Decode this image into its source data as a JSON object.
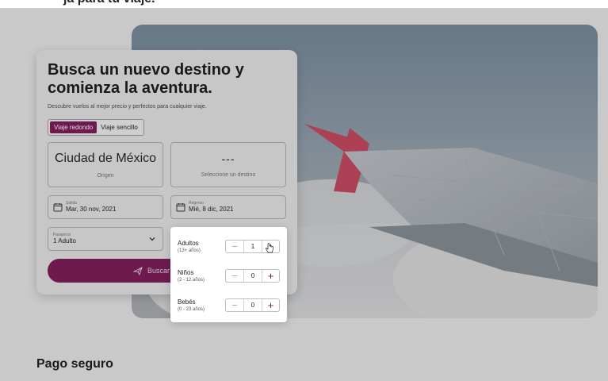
{
  "top_caption": "ja para tu viaje.",
  "hero": {
    "title": "Busca un nuevo destino y comienza la aventura.",
    "subtitle": "Descubre vuelos al mejor precio y perfectos para cualquier viaje."
  },
  "trip_type": {
    "options": [
      "Viaje redondo",
      "Viaje sencillo"
    ],
    "selected": "Viaje redondo"
  },
  "origin": {
    "value": "Ciudad de México",
    "label": "Origen"
  },
  "destination": {
    "value": "---",
    "label": "Seleccione un destino"
  },
  "departure": {
    "small_label": "Salida",
    "value": "Mar, 30 nov, 2021"
  },
  "return": {
    "small_label": "Regreso",
    "value": "Mié, 8 dic, 2021"
  },
  "passengers": {
    "small_label": "Pasajeros",
    "value": "1 Adulto"
  },
  "search_button": {
    "label": "Buscar"
  },
  "passenger_popup": {
    "rows": [
      {
        "name": "Adultos",
        "age": "(13+ años)",
        "count": "1"
      },
      {
        "name": "Niños",
        "age": "(2 - 12 años)",
        "count": "0"
      },
      {
        "name": "Bebés",
        "age": "(0 - 23 años)",
        "count": "0"
      }
    ]
  },
  "section_title": "Pago seguro",
  "colors": {
    "brand": "#6e1a4f",
    "wingtip": "#d2506a"
  },
  "icons": [
    "calendar-icon",
    "chevron-down-icon",
    "plane-icon",
    "minus-icon",
    "plus-icon",
    "hand-cursor-icon"
  ]
}
